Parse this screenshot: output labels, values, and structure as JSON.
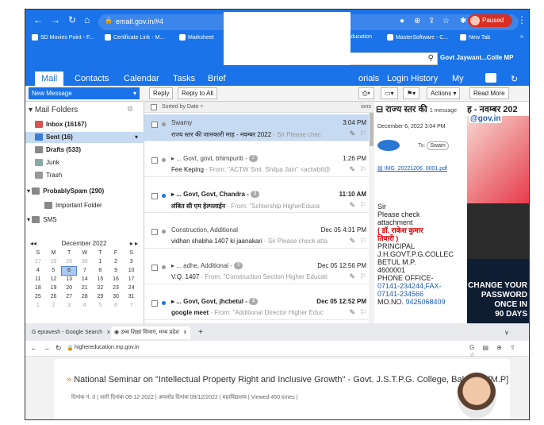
{
  "browser1": {
    "url": "email.gov.in/#4",
    "profile_label": "Paused",
    "bookmarks": [
      "SD Movies Point - F...",
      "Certificate Link - M...",
      "Marksheet",
      "h Education",
      "MasterSoftware - C...",
      "New Tab"
    ],
    "more_bookmarks": "»"
  },
  "app": {
    "user_label": "Govt Jaywant...Colle MP",
    "search_icon": "magnifier",
    "nav_tabs": [
      "Mail",
      "Contacts",
      "Calendar",
      "Tasks",
      "Brief",
      "orials",
      "Login History",
      "My"
    ],
    "toolbar": {
      "new_message": "New Message",
      "reply": "Reply",
      "reply_all": "Reply to All",
      "actions": "Actions",
      "read_more": "Read More"
    }
  },
  "folders": {
    "header": "Mail Folders",
    "items": [
      {
        "label": "Inbox (16167)",
        "icon": "inbox-icon",
        "color": "#d9534f"
      },
      {
        "label": "Sent (16)",
        "icon": "sent-icon",
        "color": "#3a7bd5"
      },
      {
        "label": "Drafts (533)",
        "icon": "drafts-icon",
        "color": "#888888"
      },
      {
        "label": "Junk",
        "icon": "junk-icon",
        "color": "#888888"
      },
      {
        "label": "Trash",
        "icon": "trash-icon",
        "color": "#888888"
      },
      {
        "label": "ProbablySpam (290)",
        "icon": "folder-icon",
        "color": "#888888"
      },
      {
        "label": "Important Folder",
        "icon": "folder-icon",
        "color": "#888888"
      },
      {
        "label": "SMS",
        "icon": "sms-icon",
        "color": "#888888"
      }
    ]
  },
  "calendar": {
    "month": "December 2022",
    "weekdays": [
      "S",
      "M",
      "T",
      "W",
      "T",
      "F",
      "S"
    ],
    "weeks": [
      [
        "27",
        "28",
        "29",
        "30",
        "1",
        "2",
        "3"
      ],
      [
        "4",
        "5",
        "6",
        "7",
        "8",
        "9",
        "10"
      ],
      [
        "11",
        "12",
        "13",
        "14",
        "15",
        "16",
        "17"
      ],
      [
        "18",
        "19",
        "20",
        "21",
        "22",
        "23",
        "24"
      ],
      [
        "25",
        "26",
        "27",
        "28",
        "29",
        "30",
        "31"
      ],
      [
        "1",
        "2",
        "3",
        "4",
        "5",
        "6",
        "7"
      ]
    ],
    "today": "6"
  },
  "messages": {
    "sort_label": "Sorted by Date",
    "list_header_right": "ions",
    "items": [
      {
        "from": "Swamy",
        "date": "3:04 PM",
        "subject": "राज्य स्तर की जानकारी माह - नवम्बर 2022",
        "snippet": "- Sir Please chec",
        "selected": true,
        "unread": false
      },
      {
        "from": "▸ ... Govt, govt, bhimpuriti",
        "badge": "2",
        "date": "1:26 PM",
        "subject": "Fee Keping",
        "snippet": "- From: \"ACTW Smt. Shilpa Jain\" <actwbtl@",
        "selected": false,
        "unread": false
      },
      {
        "from": "▸ ... Govt, Govt, Chandra",
        "badge": "3",
        "date": "11:10 AM",
        "subject": "लंबित सी एम हेल्पलाईन",
        "snippet": "- From: \"Schlorship HigherEduca",
        "selected": false,
        "unread": true
      },
      {
        "from": "Construction, Additional",
        "date": "Dec 05 4:31 PM",
        "subject": "vidhan shabha  1407 ki jaanakari",
        "snippet": "- Sir Please check atta",
        "selected": false,
        "unread": false
      },
      {
        "from": "▸ ... adhe, Additional",
        "badge": "3",
        "date": "Dec 05 12:56 PM",
        "subject": "V.Q. 1407",
        "snippet": "- From: \"Construction Section Higher Educati",
        "selected": false,
        "unread": false
      },
      {
        "from": "▸ ... Govt, Govt, jhcbetul",
        "badge": "2",
        "date": "Dec 05 12:52 PM",
        "subject": "google meet",
        "snippet": "- From: \"Additional Director Higher Educ",
        "selected": false,
        "unread": true
      }
    ]
  },
  "reader": {
    "title": "राज्य स्तर की",
    "count": "1 message",
    "date": "December 6, 2022 3:04 PM",
    "to_label": "To:",
    "to_name": "Swam",
    "attachment": "IMG_20221206_0001.pdf",
    "body": {
      "greeting": "Sir",
      "line1": "Please check",
      "line2": "attachment",
      "sig_name": "( डॉ. राकेश कुमार",
      "sig_name2": "तिवारी )",
      "role": "PRINCIPAL",
      "college": "J.H.GOVT.P.G.COLLEC",
      "city": "BETUL M.P.",
      "pin": "4600001",
      "phone_label": "PHONE OFFICE-",
      "phone": "07141-234244,FAX-",
      "fax": "07141-234566",
      "mo_label": "MO.NO.",
      "mo": "9425068409"
    }
  },
  "ad": {
    "heading": "ह - नवम्बर 202",
    "logo": "@gov.in",
    "lines": [
      "CHANGE YOUR",
      "PASSWORD",
      "ONCE IN",
      "90 DAYS"
    ]
  },
  "browser2": {
    "tabs": [
      "epravesh - Google Search",
      "उच्च शिक्षा विभाग, मध्य प्रदेश"
    ],
    "new_tab": "+",
    "url": "highereducation.mp.gov.in",
    "article_title": "National Seminar on \"Intellectual Property Right and Inclusive Growth\" - Govt. J.S.T.P.G. College, Balaghat [M.P]",
    "article_meta": "दिनांक नं. 0 | जारी दिनांक 08-12-2022 | अपलोड दिनांक 08/12/2022 | महाविद्यालय | Viewed 450 times |"
  },
  "colors": {
    "brand_blue": "#1a73e8",
    "selected_row": "#c6daf2",
    "paused_red": "#d93025"
  }
}
